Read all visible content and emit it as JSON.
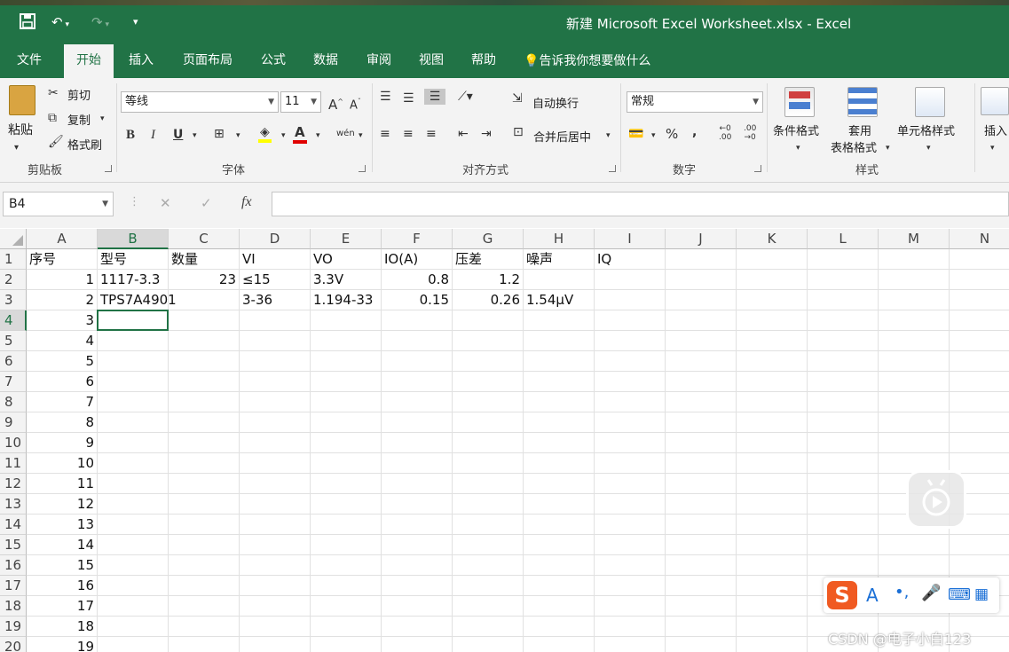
{
  "title_bar": {
    "window_title": "新建 Microsoft Excel Worksheet.xlsx  -  Excel",
    "save_icon": "save-icon",
    "undo_icon": "undo-icon",
    "redo_icon": "redo-icon",
    "customize_icon": "customize-icon"
  },
  "menu": {
    "tabs": [
      "文件",
      "开始",
      "插入",
      "页面布局",
      "公式",
      "数据",
      "审阅",
      "视图",
      "帮助"
    ],
    "active_tab": "开始",
    "tell_me": "告诉我你想要做什么"
  },
  "ribbon": {
    "clipboard": {
      "label": "剪贴板",
      "paste": "粘贴",
      "cut": "剪切",
      "copy": "复制",
      "format_painter": "格式刷"
    },
    "font": {
      "label": "字体",
      "font_name": "等线",
      "font_size": "11",
      "bold": "B",
      "italic": "I",
      "underline": "U",
      "grow": "A",
      "shrink": "A",
      "font_color": "A",
      "phonetic": "wén"
    },
    "alignment": {
      "label": "对齐方式",
      "wrap": "自动换行",
      "merge": "合并后居中"
    },
    "number": {
      "label": "数字",
      "format": "常规",
      "percent": "%",
      "comma": ",",
      "inc_decimal": ".00",
      "dec_decimal": ".00"
    },
    "styles": {
      "label": "样式",
      "conditional": "条件格式",
      "table_format_1": "套用",
      "table_format_2": "表格格式",
      "cell_styles": "单元格样式"
    },
    "cells": {
      "insert": "插入"
    }
  },
  "formula_bar": {
    "name_box": "B4",
    "cancel": "✕",
    "enter": "✓",
    "fx": "fx",
    "content": ""
  },
  "sheet": {
    "columns": [
      "A",
      "B",
      "C",
      "D",
      "E",
      "F",
      "G",
      "H",
      "I",
      "J",
      "K",
      "L",
      "M",
      "N"
    ],
    "selected_col": "B",
    "selected_row": "4",
    "rows": [
      {
        "n": "1",
        "cells": [
          "序号",
          "型号",
          "数量",
          "VI",
          "VO",
          "IO(A)",
          "压差",
          "噪声",
          "IQ",
          "",
          "",
          "",
          "",
          ""
        ]
      },
      {
        "n": "2",
        "cells": [
          "1",
          "1117-3.3",
          "23",
          "≤15",
          "3.3V",
          "0.8",
          "1.2",
          "",
          "",
          "",
          "",
          "",
          "",
          ""
        ]
      },
      {
        "n": "3",
        "cells": [
          "2",
          "TPS7A4901",
          "",
          "3-36",
          "1.194-33",
          "0.15",
          "0.26",
          "1.54μV",
          "",
          "",
          "",
          "",
          "",
          ""
        ]
      },
      {
        "n": "4",
        "cells": [
          "3",
          "",
          "",
          "",
          "",
          "",
          "",
          "",
          "",
          "",
          "",
          "",
          "",
          ""
        ]
      },
      {
        "n": "5",
        "cells": [
          "4",
          "",
          "",
          "",
          "",
          "",
          "",
          "",
          "",
          "",
          "",
          "",
          "",
          ""
        ]
      },
      {
        "n": "6",
        "cells": [
          "5",
          "",
          "",
          "",
          "",
          "",
          "",
          "",
          "",
          "",
          "",
          "",
          "",
          ""
        ]
      },
      {
        "n": "7",
        "cells": [
          "6",
          "",
          "",
          "",
          "",
          "",
          "",
          "",
          "",
          "",
          "",
          "",
          "",
          ""
        ]
      },
      {
        "n": "8",
        "cells": [
          "7",
          "",
          "",
          "",
          "",
          "",
          "",
          "",
          "",
          "",
          "",
          "",
          "",
          ""
        ]
      },
      {
        "n": "9",
        "cells": [
          "8",
          "",
          "",
          "",
          "",
          "",
          "",
          "",
          "",
          "",
          "",
          "",
          "",
          ""
        ]
      },
      {
        "n": "10",
        "cells": [
          "9",
          "",
          "",
          "",
          "",
          "",
          "",
          "",
          "",
          "",
          "",
          "",
          "",
          ""
        ]
      },
      {
        "n": "11",
        "cells": [
          "10",
          "",
          "",
          "",
          "",
          "",
          "",
          "",
          "",
          "",
          "",
          "",
          "",
          ""
        ]
      },
      {
        "n": "12",
        "cells": [
          "11",
          "",
          "",
          "",
          "",
          "",
          "",
          "",
          "",
          "",
          "",
          "",
          "",
          ""
        ]
      },
      {
        "n": "13",
        "cells": [
          "12",
          "",
          "",
          "",
          "",
          "",
          "",
          "",
          "",
          "",
          "",
          "",
          "",
          ""
        ]
      },
      {
        "n": "14",
        "cells": [
          "13",
          "",
          "",
          "",
          "",
          "",
          "",
          "",
          "",
          "",
          "",
          "",
          "",
          ""
        ]
      },
      {
        "n": "15",
        "cells": [
          "14",
          "",
          "",
          "",
          "",
          "",
          "",
          "",
          "",
          "",
          "",
          "",
          "",
          ""
        ]
      },
      {
        "n": "16",
        "cells": [
          "15",
          "",
          "",
          "",
          "",
          "",
          "",
          "",
          "",
          "",
          "",
          "",
          "",
          ""
        ]
      },
      {
        "n": "17",
        "cells": [
          "16",
          "",
          "",
          "",
          "",
          "",
          "",
          "",
          "",
          "",
          "",
          "",
          "",
          ""
        ]
      },
      {
        "n": "18",
        "cells": [
          "17",
          "",
          "",
          "",
          "",
          "",
          "",
          "",
          "",
          "",
          "",
          "",
          "",
          ""
        ]
      },
      {
        "n": "19",
        "cells": [
          "18",
          "",
          "",
          "",
          "",
          "",
          "",
          "",
          "",
          "",
          "",
          "",
          "",
          ""
        ]
      },
      {
        "n": "20",
        "cells": [
          "19",
          "",
          "",
          "",
          "",
          "",
          "",
          "",
          "",
          "",
          "",
          "",
          "",
          ""
        ]
      }
    ],
    "numeric_cols": [
      0,
      2,
      5,
      6
    ]
  },
  "overlays": {
    "ime_letter": "A",
    "watermark": "CSDN @电子小白123"
  },
  "colors": {
    "excel_green": "#217346",
    "ribbon_bg": "#f3f3f3",
    "ime_orange": "#f05a22",
    "ime_blue": "#1a6fd6"
  }
}
